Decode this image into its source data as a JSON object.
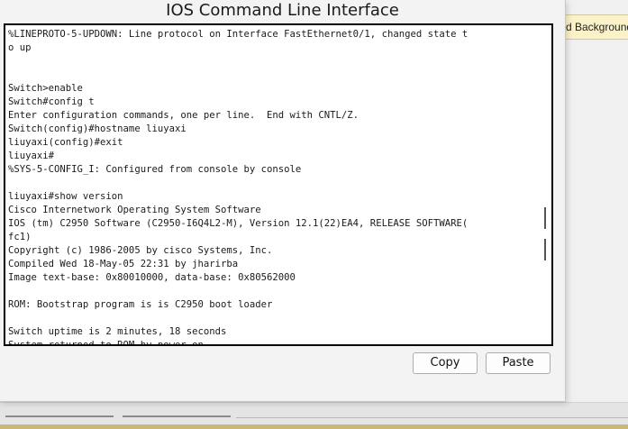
{
  "window": {
    "title": "IOS Command Line Interface"
  },
  "background": {
    "tab_label": "d Background"
  },
  "terminal": {
    "lines": [
      "%LINEPROTO-5-UPDOWN: Line protocol on Interface FastEthernet0/1, changed state t",
      "o up",
      "",
      "",
      "Switch>enable",
      "Switch#config t",
      "Enter configuration commands, one per line.  End with CNTL/Z.",
      "Switch(config)#hostname liuyaxi",
      "liuyaxi(config)#exit",
      "liuyaxi#",
      "%SYS-5-CONFIG_I: Configured from console by console",
      "",
      "liuyaxi#show version",
      "Cisco Internetwork Operating System Software",
      "IOS (tm) C2950 Software (C2950-I6Q4L2-M), Version 12.1(22)EA4, RELEASE SOFTWARE(",
      "fc1)",
      "Copyright (c) 1986-2005 by cisco Systems, Inc.",
      "Compiled Wed 18-May-05 22:31 by jharirba",
      "Image text-base: 0x80010000, data-base: 0x80562000",
      "",
      "ROM: Bootstrap program is is C2950 boot loader",
      "",
      "Switch uptime is 2 minutes, 18 seconds",
      "System returned to ROM by power-on"
    ]
  },
  "buttons": {
    "copy_label": "Copy",
    "paste_label": "Paste"
  }
}
